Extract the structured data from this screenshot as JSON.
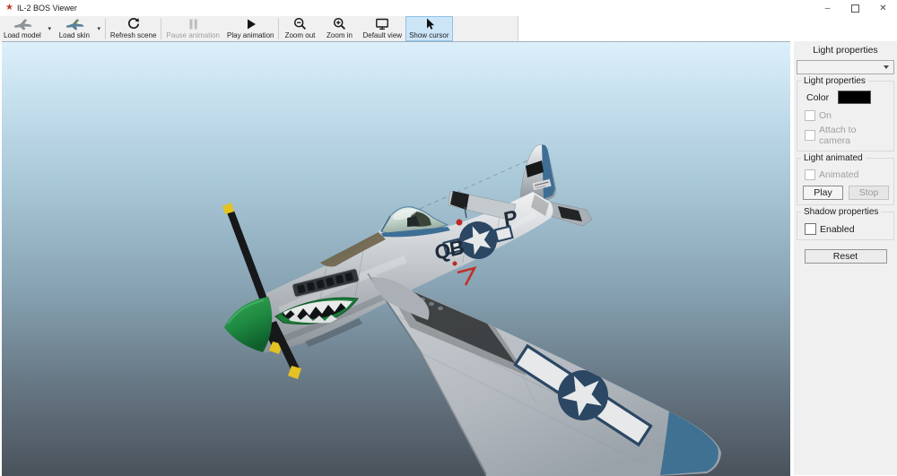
{
  "window": {
    "title": "IL-2 BOS Viewer",
    "icons": {
      "app_star": "★",
      "minimize": "–",
      "close": "✕",
      "dropdown_arrow": "▾"
    }
  },
  "toolbar": {
    "buttons": [
      {
        "label": "Load model",
        "icon": "airplane-gray",
        "has_dropdown": true
      },
      {
        "label": "Load skin",
        "icon": "airplane-colored",
        "has_dropdown": true
      },
      {
        "label": "Refresh scene",
        "icon": "refresh"
      },
      {
        "label": "Pause animation",
        "icon": "pause",
        "disabled": true
      },
      {
        "label": "Play animation",
        "icon": "play"
      },
      {
        "label": "Zoom out",
        "icon": "zoom-out"
      },
      {
        "label": "Zoom in",
        "icon": "zoom-in"
      },
      {
        "label": "Default view",
        "icon": "monitor"
      },
      {
        "label": "Show cursor",
        "icon": "cursor",
        "active": true
      }
    ]
  },
  "panel": {
    "title": "Light properties",
    "dropdown_value": "",
    "light_properties": {
      "label": "Light properties",
      "color_label": "Color",
      "color_value": "#000000",
      "on_label": "On",
      "attach_label": "Attach to camera"
    },
    "light_animated": {
      "label": "Light animated",
      "animated_label": "Animated",
      "play_label": "Play",
      "stop_label": "Stop"
    },
    "shadow": {
      "label": "Shadow properties",
      "enabled_label": "Enabled"
    },
    "reset_label": "Reset"
  },
  "aircraft": {
    "code_left": "QB",
    "code_right": "P"
  },
  "colors": {
    "toolbar_active_bg": "#cce5f7",
    "toolbar_active_border": "#8fc2e6",
    "panel_bg": "#f0f0f0",
    "sky_top": "#dceffb",
    "sky_bottom": "#4a525b",
    "spinner_green": "#27954a",
    "insignia_navy": "#2b4763",
    "tail_blue": "#3e6e94",
    "prop_tip_yellow": "#e3c222"
  }
}
